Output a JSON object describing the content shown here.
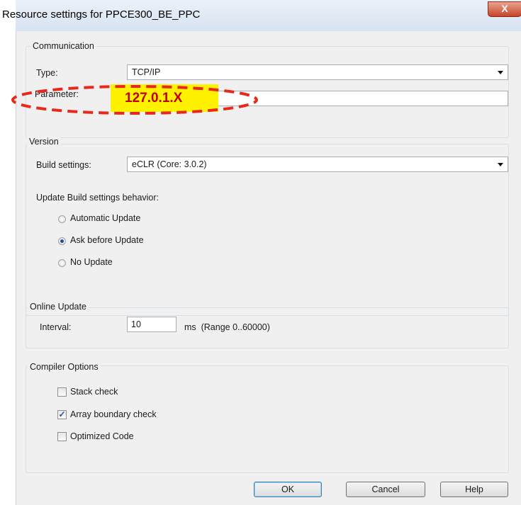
{
  "window": {
    "title": "Resource settings for PPCE300_BE_PPC",
    "close_glyph": "X"
  },
  "communication": {
    "legend": "Communication",
    "type_label": "Type:",
    "type_value": "TCP/IP",
    "parameter_label": "Parameter:",
    "parameter_value": "",
    "annotation": "127.0.1.X",
    "annotation_color": "#c00000",
    "highlight_color": "#fff200"
  },
  "version": {
    "legend": "Version",
    "build_label": "Build settings:",
    "build_value": "eCLR (Core: 3.0.2)",
    "behavior_label": "Update Build settings behavior:",
    "options": [
      {
        "label": "Automatic Update",
        "selected": false
      },
      {
        "label": "Ask before Update",
        "selected": true
      },
      {
        "label": "No Update",
        "selected": false
      }
    ]
  },
  "online_update": {
    "legend": "Online Update",
    "interval_label": "Interval:",
    "interval_value": "10",
    "range_text": "ms  (Range 0..60000)"
  },
  "compiler": {
    "legend": "Compiler Options",
    "options": [
      {
        "label": "Stack check",
        "checked": false
      },
      {
        "label": "Array boundary check",
        "checked": true
      },
      {
        "label": "Optimized Code",
        "checked": false
      }
    ]
  },
  "buttons": {
    "ok": "OK",
    "cancel": "Cancel",
    "help": "Help"
  }
}
